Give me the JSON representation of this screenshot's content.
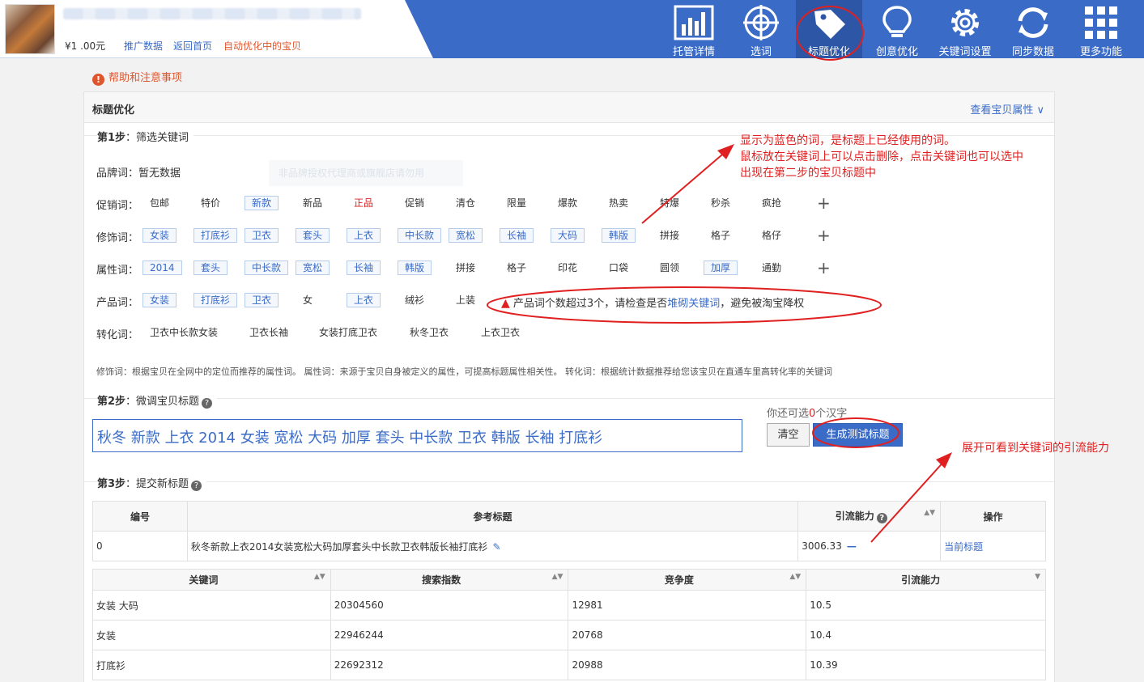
{
  "header": {
    "price": "¥1 .00元",
    "links": [
      "推广数据",
      "返回首页"
    ],
    "auto_link": "自动优化中的宝贝",
    "nav": [
      "托管详情",
      "选词",
      "标题优化",
      "创意优化",
      "关键词设置",
      "同步数据",
      "更多功能"
    ],
    "nav_icons": [
      "bar-chart-icon",
      "crosshair-icon",
      "tag-icon",
      "lightbulb-icon",
      "gear-icon",
      "sync-icon",
      "grid-icon"
    ]
  },
  "help": {
    "icon": "!",
    "text": "帮助和注意事项"
  },
  "panel": {
    "title": "标题优化",
    "view_attr": "查看宝贝属性 ∨"
  },
  "step1": {
    "label": "第1步",
    "text": "：筛选关键词",
    "brand_label": "品牌词：暂无数据",
    "ghost_text": "非品牌授权代理商或旗舰店请勿用",
    "rows": [
      {
        "label": "促销词：",
        "words": [
          {
            "t": "包邮",
            "s": ""
          },
          {
            "t": "特价",
            "s": ""
          },
          {
            "t": "新款",
            "s": "blue"
          },
          {
            "t": "新品",
            "s": ""
          },
          {
            "t": "正品",
            "s": "red"
          },
          {
            "t": "促销",
            "s": ""
          },
          {
            "t": "清仓",
            "s": ""
          },
          {
            "t": "限量",
            "s": ""
          },
          {
            "t": "爆款",
            "s": ""
          },
          {
            "t": "热卖",
            "s": ""
          },
          {
            "t": "特爆",
            "s": ""
          },
          {
            "t": "秒杀",
            "s": ""
          },
          {
            "t": "疯抢",
            "s": ""
          }
        ],
        "plus": true
      },
      {
        "label": "修饰词：",
        "words": [
          {
            "t": "女装",
            "s": "blue"
          },
          {
            "t": "打底衫",
            "s": "blue"
          },
          {
            "t": "卫衣",
            "s": "blue"
          },
          {
            "t": "套头",
            "s": "blue"
          },
          {
            "t": "上衣",
            "s": "blue"
          },
          {
            "t": "中长款",
            "s": "blue"
          },
          {
            "t": "宽松",
            "s": "blue"
          },
          {
            "t": "长袖",
            "s": "blue"
          },
          {
            "t": "大码",
            "s": "blue"
          },
          {
            "t": "韩版",
            "s": "blue"
          },
          {
            "t": "拼接",
            "s": ""
          },
          {
            "t": "格子",
            "s": ""
          },
          {
            "t": "格仔",
            "s": ""
          }
        ],
        "plus": true
      },
      {
        "label": "属性词：",
        "words": [
          {
            "t": "2014",
            "s": "blue"
          },
          {
            "t": "套头",
            "s": "blue"
          },
          {
            "t": "中长款",
            "s": "blue"
          },
          {
            "t": "宽松",
            "s": "blue"
          },
          {
            "t": "长袖",
            "s": "blue"
          },
          {
            "t": "韩版",
            "s": "blue"
          },
          {
            "t": "拼接",
            "s": ""
          },
          {
            "t": "格子",
            "s": ""
          },
          {
            "t": "印花",
            "s": ""
          },
          {
            "t": "口袋",
            "s": ""
          },
          {
            "t": "圆领",
            "s": ""
          },
          {
            "t": "加厚",
            "s": "blue"
          },
          {
            "t": "通勤",
            "s": ""
          }
        ],
        "plus": true
      },
      {
        "label": "产品词：",
        "words": [
          {
            "t": "女装",
            "s": "blue"
          },
          {
            "t": "打底衫",
            "s": "blue"
          },
          {
            "t": "卫衣",
            "s": "blue"
          },
          {
            "t": "女",
            "s": ""
          },
          {
            "t": "上衣",
            "s": "blue"
          },
          {
            "t": "绒衫",
            "s": ""
          },
          {
            "t": "上装",
            "s": ""
          }
        ],
        "plus": false
      },
      {
        "label": "转化词：",
        "words": [
          {
            "t": "卫衣中长款女装",
            "s": ""
          },
          {
            "t": "卫衣长袖",
            "s": ""
          },
          {
            "t": "女装打底卫衣",
            "s": ""
          },
          {
            "t": "秋冬卫衣",
            "s": ""
          },
          {
            "t": "上衣卫衣",
            "s": ""
          }
        ],
        "plus": false
      }
    ],
    "warn_pre": "产品词个数超过3个，请检查是否",
    "warn_link": "堆砌关键词",
    "warn_post": "，避免被淘宝降权",
    "note": "修饰词：根据宝贝在全网中的定位而推荐的属性词。 属性词：来源于宝贝自身被定义的属性，可提高标题属性相关性。 转化词：根据统计数据推荐给您该宝贝在直通车里高转化率的关键词"
  },
  "step2": {
    "label": "第2步",
    "text": "：微调宝贝标题",
    "title_value": "秋冬 新款 上衣 2014 女装 宽松 大码 加厚 套头 中长款 卫衣 韩版 长袖 打底衫",
    "remain_pre": "你还可选",
    "remain_num": "0",
    "remain_post": "个汉字",
    "btn_clear": "清空",
    "btn_generate": "生成测试标题"
  },
  "step3": {
    "label": "第3步",
    "text": "：提交新标题",
    "table_headers": [
      "编号",
      "参考标题",
      "引流能力",
      "操作"
    ],
    "row": {
      "id": "0",
      "title": "秋冬新款上衣2014女装宽松大码加厚套头中长款卫衣韩版长袖打底衫",
      "power": "3006.33",
      "op": "当前标题"
    },
    "kw_headers": [
      "关键词",
      "搜索指数",
      "竞争度",
      "引流能力"
    ],
    "kw_rows": [
      [
        "女装 大码",
        "20304560",
        "12981",
        "10.5"
      ],
      [
        "女装",
        "22946244",
        "20768",
        "10.4"
      ],
      [
        "打底衫",
        "22692312",
        "20988",
        "10.39"
      ]
    ]
  },
  "annotations": {
    "note1": [
      "显示为蓝色的词，是标题上已经使用的词。",
      "鼠标放在关键词上可以点击删除，点击关键词也可以选中",
      "出现在第二步的宝贝标题中"
    ],
    "note2": "展开可看到关键词的引流能力"
  },
  "colors": {
    "header_blue": "#3a6bc6",
    "accent_red": "#e02020",
    "link_blue": "#3a6bc6",
    "orange": "#e0552b"
  }
}
